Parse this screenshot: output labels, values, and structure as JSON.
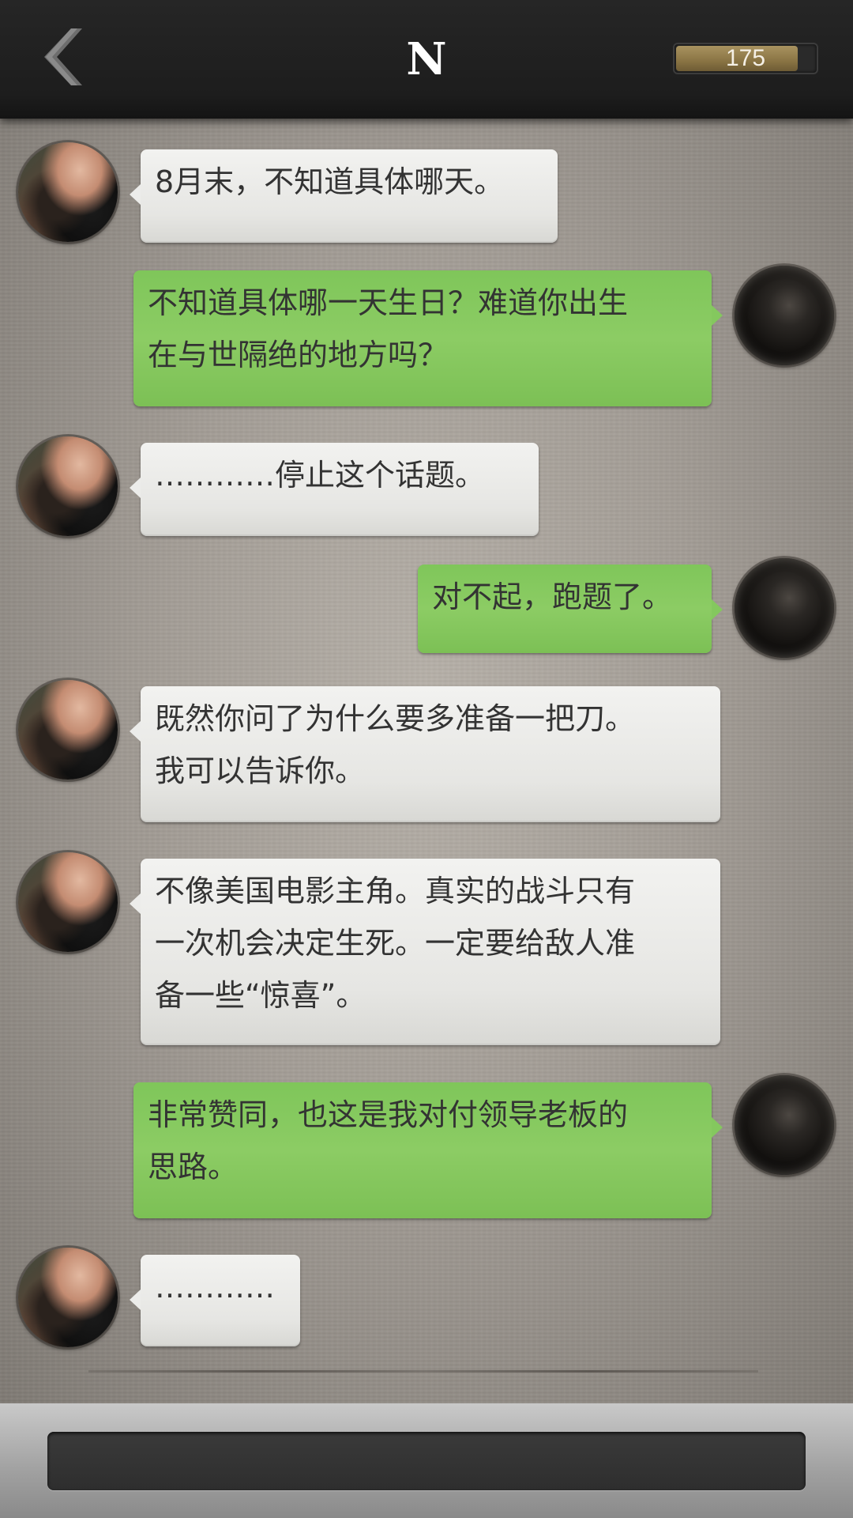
{
  "header": {
    "back_icon": "chevron-left-icon",
    "title": "N",
    "points": {
      "value": "175",
      "fill_fraction": 0.88,
      "color": "#8a7444"
    }
  },
  "contacts": {
    "left_avatar": "contact-avatar",
    "right_avatar": "user-avatar"
  },
  "messages": [
    {
      "side": "left",
      "text": "8月末，不知道具体哪天。"
    },
    {
      "side": "right",
      "text": "不知道具体哪一天生日？难道你出生\n在与世隔绝的地方吗？"
    },
    {
      "side": "left",
      "text": "…………停止这个话题。"
    },
    {
      "side": "right",
      "text": "对不起，跑题了。"
    },
    {
      "side": "left",
      "text": "既然你问了为什么要多准备一把刀。\n我可以告诉你。"
    },
    {
      "side": "left",
      "text": "不像美国电影主角。真实的战斗只有\n一次机会决定生死。一定要给敌人准\n备一些“惊喜”。"
    },
    {
      "side": "right",
      "text": "非常赞同，也这是我对付领导老板的\n思路。"
    },
    {
      "side": "left",
      "text": "…………"
    }
  ],
  "colors": {
    "header_bg": "#1d1d1d",
    "bubble_white": "#ececea",
    "bubble_green": "#84c85e",
    "text": "#333333"
  }
}
